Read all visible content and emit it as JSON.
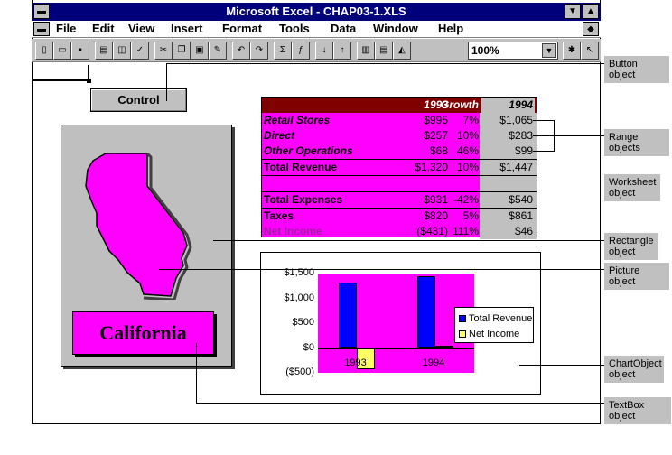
{
  "window": {
    "title": "Microsoft Excel - CHAP03-1.XLS"
  },
  "menu": [
    {
      "label": "File"
    },
    {
      "label": "Edit"
    },
    {
      "label": "View"
    },
    {
      "label": "Insert"
    },
    {
      "label": "Format"
    },
    {
      "label": "Tools"
    },
    {
      "label": "Data"
    },
    {
      "label": "Window"
    },
    {
      "label": "Help"
    }
  ],
  "toolbar": {
    "zoom": "100%"
  },
  "sheet": {
    "control_button": "Control",
    "textbox": "California"
  },
  "range_table": {
    "headers": [
      "",
      "1993",
      "Growth",
      "1994"
    ],
    "rows": [
      [
        "Retail Stores",
        "$995",
        "7%",
        "$1,065"
      ],
      [
        "Direct",
        "$257",
        "10%",
        "$283"
      ],
      [
        "Other Operations",
        "$68",
        "46%",
        "$99"
      ],
      [
        "Total Revenue",
        "$1,320",
        "10%",
        "$1,447"
      ],
      [
        "",
        "",
        "",
        ""
      ],
      [
        "Total Expenses",
        "$931",
        "-42%",
        "$540"
      ],
      [
        "Taxes",
        "$820",
        "5%",
        "$861"
      ],
      [
        "Net Income",
        "($431)",
        "111%",
        "$46"
      ]
    ]
  },
  "chart_data": {
    "type": "bar",
    "categories": [
      "1993",
      "1994"
    ],
    "series": [
      {
        "name": "Total Revenue",
        "values": [
          1320,
          1447
        ],
        "color": "#0000ff"
      },
      {
        "name": "Net Income",
        "values": [
          -431,
          46
        ],
        "color": "#ffff66"
      }
    ],
    "yticks": [
      "$1,500",
      "$1,000",
      "$500",
      "$0",
      "($500)"
    ],
    "ylim": [
      -500,
      1500
    ],
    "legend": "right",
    "plot_bg": "#ff00ff"
  },
  "callouts": {
    "button": "Button object",
    "range": "Range objects",
    "worksheet": "Worksheet object",
    "rectangle": "Rectangle object",
    "picture": "Picture object",
    "chartobject": "ChartObject object",
    "textbox": "TextBox object"
  }
}
